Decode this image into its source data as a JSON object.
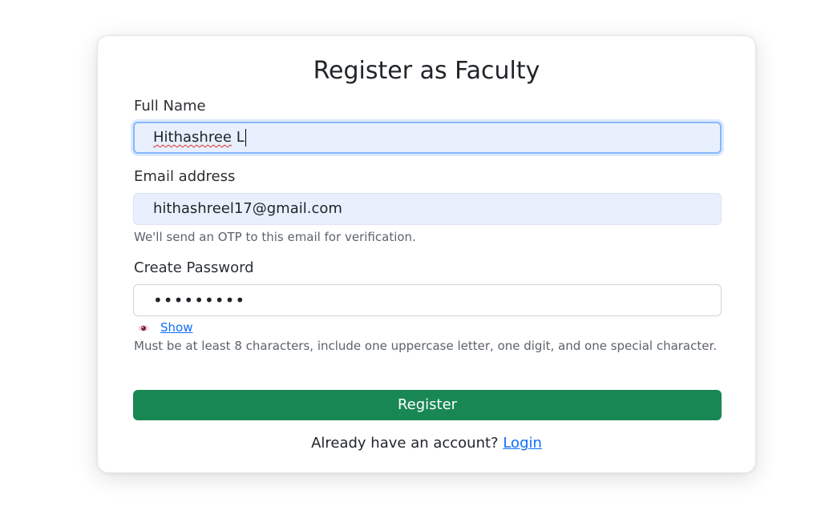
{
  "form": {
    "title": "Register as Faculty",
    "full_name": {
      "label": "Full Name",
      "value_word1": "Hithashree",
      "value_word2": " L"
    },
    "email": {
      "label": "Email address",
      "value": "hithashreel17@gmail.com",
      "help": "We'll send an OTP to this email for verification."
    },
    "password": {
      "label": "Create Password",
      "masked_value": "•••••••••",
      "show_label": "Show",
      "help": "Must be at least 8 characters, include one uppercase letter, one digit, and one special character."
    },
    "register_button": "Register",
    "footer": {
      "prompt": "Already have an account? ",
      "login_link": "Login"
    }
  },
  "colors": {
    "primary_button": "#198754",
    "link": "#0d6efd",
    "autofill_background": "#e8f0fe",
    "focus_border": "#86b7fe"
  },
  "icons": {
    "show_password": "eye-icon"
  }
}
